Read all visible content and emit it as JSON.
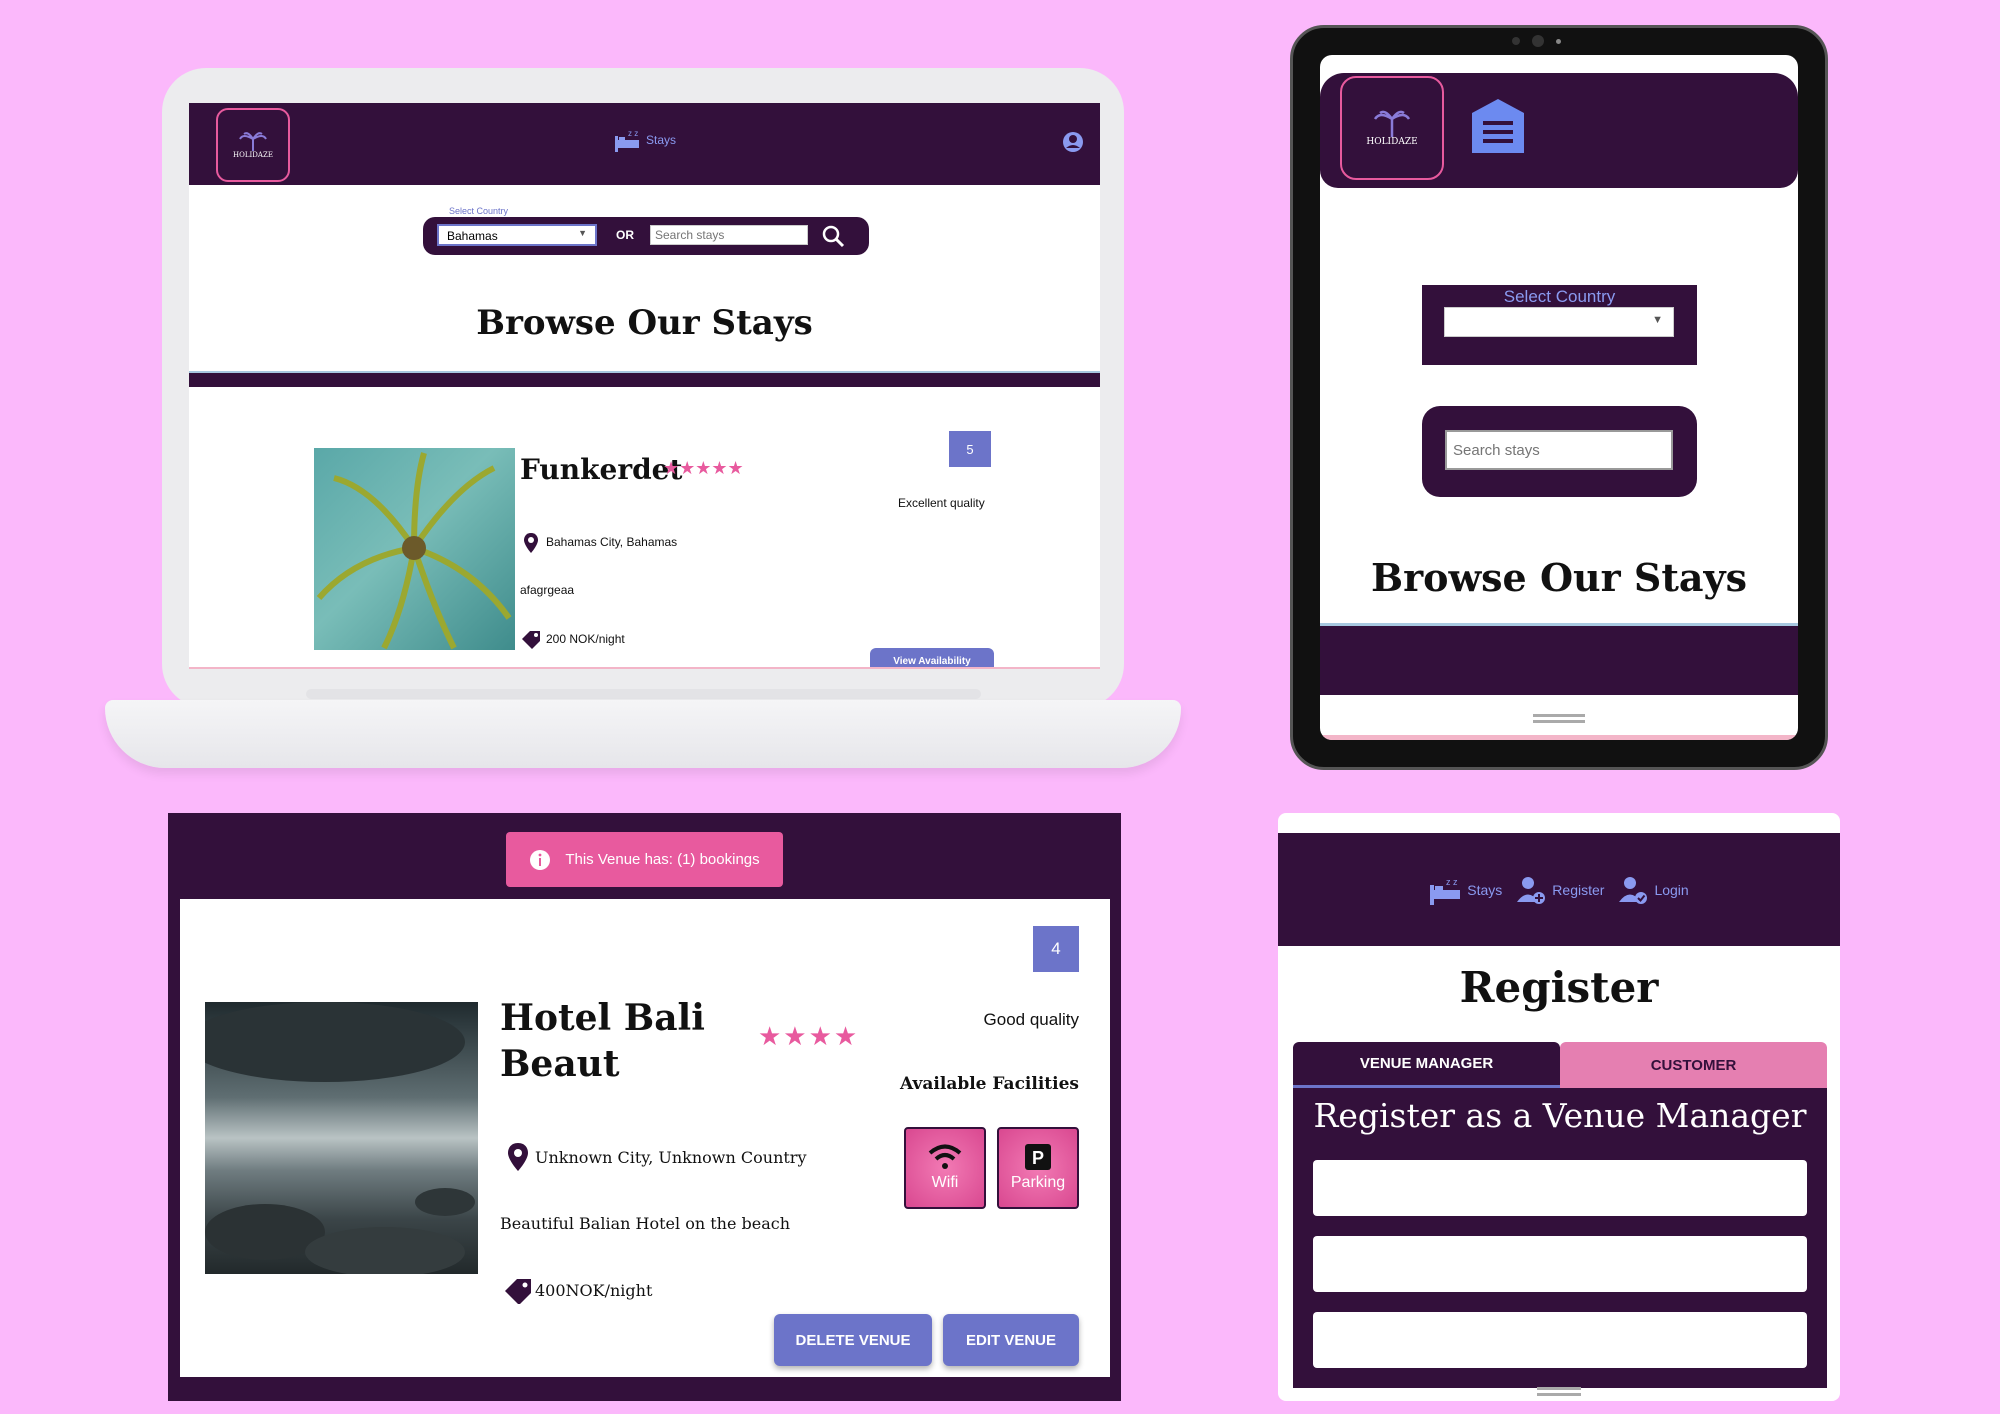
{
  "laptop": {
    "logo_text": "HOLIDAZE",
    "nav_stays": "Stays",
    "select_label": "Select Country",
    "select_value": "Bahamas",
    "or_text": "OR",
    "search_placeholder": "Search stays",
    "heading": "Browse Our Stays",
    "venue": {
      "name": "Funkerdet",
      "stars": "★★★★★",
      "rating": "5",
      "quality": "Excellent quality",
      "location": "Bahamas City, Bahamas",
      "description": "afagrgeaa",
      "price": "200 NOK/night",
      "button": "View Availability"
    }
  },
  "tablet": {
    "logo_text": "HOLIDAZE",
    "select_label": "Select Country",
    "search_placeholder": "Search stays",
    "heading": "Browse Our Stays"
  },
  "venue_detail": {
    "alert": "This Venue has: (1) bookings",
    "rating": "4",
    "name_line1": "Hotel Bali",
    "name_line2": "Beaut",
    "stars": "★★★★",
    "quality": "Good quality",
    "facilities_title": "Available Facilities",
    "facilities": [
      "Wifi",
      "Parking"
    ],
    "location": "Unknown City, Unknown Country",
    "description": "Beautiful Balian Hotel on the beach",
    "price": "400NOK/night",
    "delete_button": "DELETE VENUE",
    "edit_button": "EDIT VENUE"
  },
  "register": {
    "nav_stays": "Stays",
    "nav_register": "Register",
    "nav_login": "Login",
    "title": "Register",
    "tab_manager": "VENUE MANAGER",
    "tab_customer": "CUSTOMER",
    "form_title": "Register as a Venue Manager"
  },
  "colors": {
    "background": "#fbb8fb",
    "brand_purple": "#33103b",
    "accent_pink": "#e85a9e",
    "accent_blue": "#6c74c9"
  }
}
